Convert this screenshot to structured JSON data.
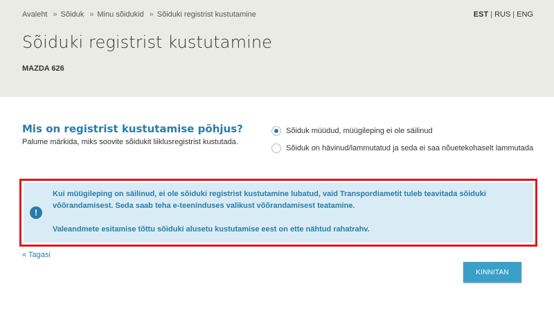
{
  "breadcrumb": {
    "items": [
      "Avaleht",
      "Sõiduk",
      "Minu sõidukid",
      "Sõiduki registrist kustutamine"
    ],
    "separator": "»"
  },
  "languages": {
    "items": [
      "EST",
      "RUS",
      "ENG"
    ],
    "active": "EST",
    "separator": "|"
  },
  "page": {
    "title": "Sõiduki registrist kustutamine",
    "vehicle": "MAZDA 626"
  },
  "form": {
    "question": "Mis on registrist kustutamise põhjus?",
    "help": "Palume märkida, miks soovite sõidukit liiklusregistrist kustutada.",
    "options": [
      {
        "label": "Sõiduk müüdud, müügileping ei ole säilinud",
        "selected": true
      },
      {
        "label": "Sõiduk on hävinud/lammutatud ja seda ei saa nõuetekohaselt lammutada",
        "selected": false
      }
    ]
  },
  "alert": {
    "icon": "exclamation-icon",
    "paragraph1": "Kui müügileping on säilinud, ei ole sõiduki registrist kustutamine lubatud, vaid Transpordiametit tuleb teavitada sõiduki võõrandamisest. Seda saab teha e-teeninduses valikust võõrandamisest teatamine.",
    "paragraph2": "Valeandmete esitamise tõttu sõiduki alusetu kustutamise eest on ette nähtud rahatrahv.",
    "highlight_color": "#e0161e"
  },
  "actions": {
    "back": "« Tagasi",
    "confirm": "KINNITAN"
  },
  "colors": {
    "accent": "#2a7ca8",
    "button": "#3aa0c7",
    "header_bg": "#ebebe6",
    "alert_bg": "#d9ecf5"
  }
}
